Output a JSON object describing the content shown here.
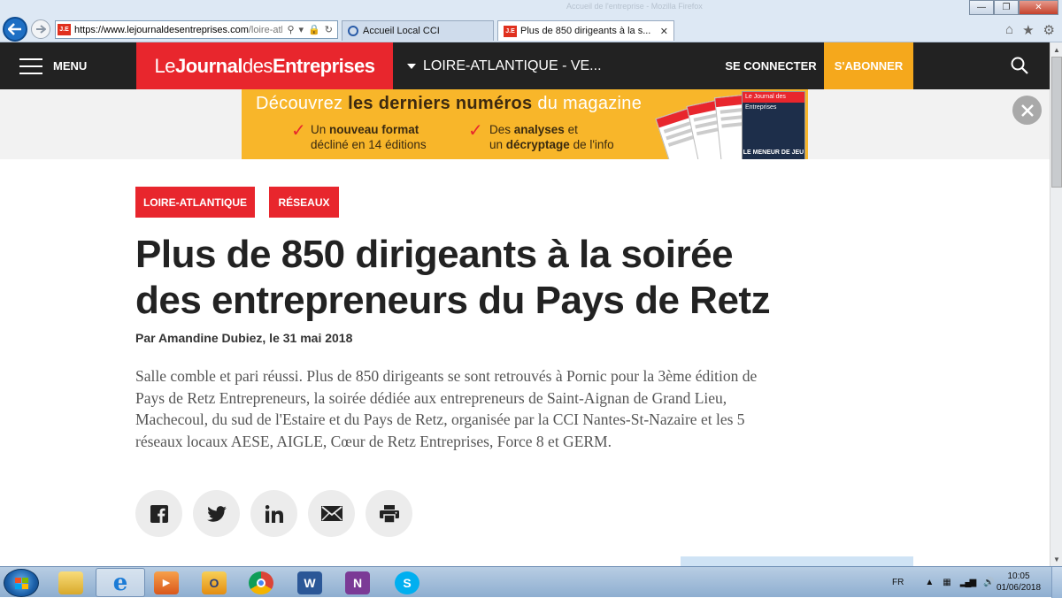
{
  "browser": {
    "url_host": "https://www.lejournaldesentreprises.com",
    "url_rest": "/loire-atla",
    "faded_title": "Accueil de l'entreprise - Mozilla Firefox",
    "tabs": [
      {
        "label": "Accueil Local CCI"
      },
      {
        "label": "Plus de 850 dirigeants à la s..."
      }
    ],
    "favicon_text": "J.E"
  },
  "header": {
    "menu_label": "MENU",
    "logo_light_1": "Le",
    "logo_bold_1": "Journal",
    "logo_light_2": "des",
    "logo_bold_2": "Entreprises",
    "region_label": "LOIRE-ATLANTIQUE - VE...",
    "login_label": "SE CONNECTER",
    "subscribe_label": "S'ABONNER"
  },
  "ad": {
    "title_1": "Découvrez ",
    "title_bold": "les derniers numéros",
    "title_2": " du magazine",
    "point1_a": "Un ",
    "point1_b": "nouveau format",
    "point1_c": "décliné en 14 éditions",
    "point2_a": "Des ",
    "point2_b": "analyses",
    "point2_c": " et",
    "point2_d": "un ",
    "point2_e": "décryptage",
    "point2_f": " de l'info",
    "cover_brand": "Le Journal des Entreprises",
    "cover_caption": "LE MENEUR DE JEU"
  },
  "article": {
    "tags": [
      "LOIRE-ATLANTIQUE",
      "RÉSEAUX"
    ],
    "title": "Plus de 850 dirigeants à la soirée des entrepreneurs du Pays de Retz",
    "byline": "Par Amandine Dubiez, le 31 mai 2018",
    "lead": "Salle comble et pari réussi. Plus de 850 dirigeants se sont retrouvés à Pornic pour la 3ème édition de Pays de Retz Entrepreneurs, la soirée dédiée aux entrepreneurs de Saint-Aignan de Grand Lieu, Machecoul, du sud de l'Estaire et du Pays de Retz, organisée par la CCI Nantes-St-Nazaire et les 5 réseaux locaux AESE, AIGLE, Cœur de Retz Entreprises, Force 8 et GERM."
  },
  "share_icons": [
    "facebook-icon",
    "twitter-icon",
    "linkedin-icon",
    "email-icon",
    "print-icon"
  ],
  "taskbar": {
    "apps": [
      "file-explorer",
      "internet-explorer",
      "media-player",
      "outlook",
      "chrome",
      "word",
      "onenote",
      "skype"
    ],
    "language": "FR",
    "time": "10:05",
    "date": "01/06/2018"
  },
  "colors": {
    "brand_red": "#e8262d",
    "subscribe_yellow": "#f5a81c",
    "header_dark": "#222222",
    "ad_yellow": "#f8b62a"
  }
}
